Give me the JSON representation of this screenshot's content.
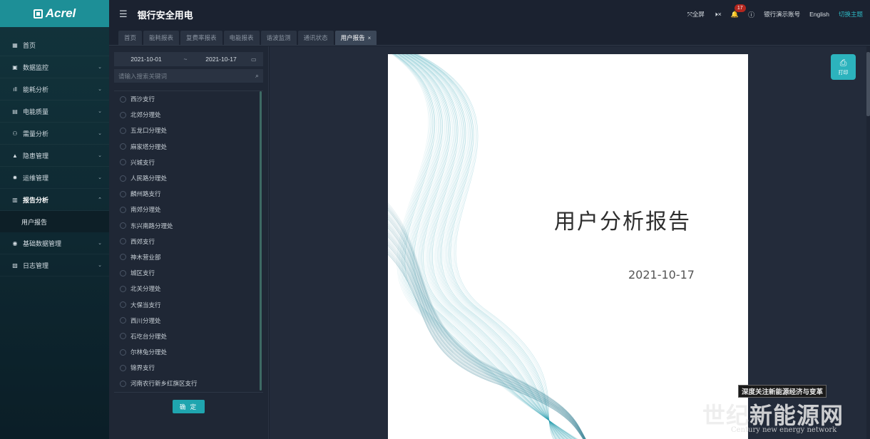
{
  "brand": {
    "logo_text": "Acrel"
  },
  "sidebar": {
    "items": [
      {
        "label": "首页",
        "icon": "home-icon",
        "arrow": ""
      },
      {
        "label": "数据监控",
        "icon": "monitor-icon",
        "arrow": "⌄"
      },
      {
        "label": "能耗分析",
        "icon": "bar-chart-icon",
        "arrow": "⌄"
      },
      {
        "label": "电能质量",
        "icon": "calendar-icon",
        "arrow": "⌄"
      },
      {
        "label": "需量分析",
        "icon": "people-icon",
        "arrow": "⌄"
      },
      {
        "label": "隐患管理",
        "icon": "warning-icon",
        "arrow": "⌄"
      },
      {
        "label": "运维管理",
        "icon": "gear-icon",
        "arrow": "⌄"
      },
      {
        "label": "报告分析",
        "icon": "report-icon",
        "arrow": "⌃"
      },
      {
        "label": "基础数据管理",
        "icon": "database-icon",
        "arrow": "⌄"
      },
      {
        "label": "日志管理",
        "icon": "log-icon",
        "arrow": "⌄"
      }
    ],
    "submenu_active": "用户报告"
  },
  "header": {
    "title": "银行安全用电",
    "fullscreen": "全屏",
    "notifications": "17",
    "account": "银行演示账号",
    "language": "English",
    "switch_theme": "切换主题"
  },
  "tabs": [
    {
      "label": "首页"
    },
    {
      "label": "能耗报表"
    },
    {
      "label": "复费率报表"
    },
    {
      "label": "电能报表"
    },
    {
      "label": "谐波监测"
    },
    {
      "label": "通讯状态"
    },
    {
      "label": "用户报告",
      "active": true
    }
  ],
  "filter": {
    "start_date": "2021-10-01",
    "separator": "~",
    "end_date": "2021-10-17",
    "search_placeholder": "请输入搜索关键词",
    "confirm_label": "确 定"
  },
  "branches": [
    "西沙支行",
    "北郊分理处",
    "五龙口分理处",
    "麻家塔分理处",
    "兴城支行",
    "人民路分理处",
    "麟州路支行",
    "南郊分理处",
    "东兴南路分理处",
    "西郊支行",
    "神木营业部",
    "城区支行",
    "北关分理处",
    "大保当支行",
    "西川分理处",
    "石圪台分理处",
    "尔林兔分理处",
    "锦界支行",
    "河南农行新乡红旗区支行"
  ],
  "report": {
    "title": "用户分析报告",
    "date": "2021-10-17",
    "print_label": "打印",
    "wave_color": "#2a9fb0"
  },
  "watermark": {
    "banner": "深度关注新能源经济与变革",
    "big": "世纪新能源网",
    "small": "Century new energy network"
  }
}
